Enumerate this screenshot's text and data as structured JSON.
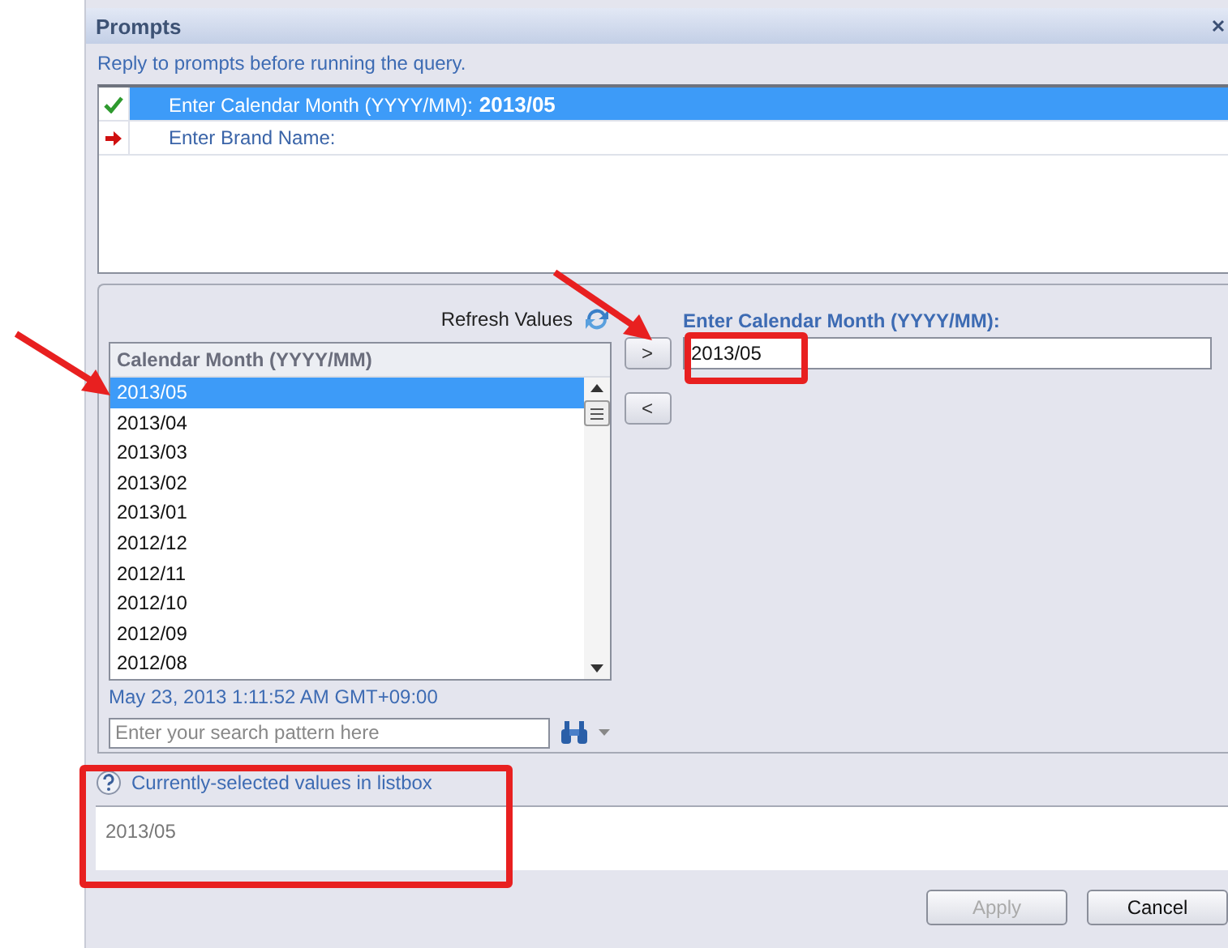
{
  "window": {
    "title": "Prompts"
  },
  "instruction": "Reply to prompts before running the query.",
  "prompts": [
    {
      "kind": "answered",
      "label": "Enter Calendar Month (YYYY/MM):",
      "value": "2013/05",
      "selected": true
    },
    {
      "kind": "pending",
      "label": "Enter Brand Name:",
      "selected": false
    }
  ],
  "refresh": {
    "label": "Refresh Values"
  },
  "listbox": {
    "header": "Calendar Month (YYYY/MM)",
    "rows": [
      {
        "label": "2013/05",
        "selected": true
      },
      {
        "label": "2013/04",
        "selected": false
      },
      {
        "label": "2013/03",
        "selected": false
      },
      {
        "label": "2013/02",
        "selected": false
      },
      {
        "label": "2013/01",
        "selected": false
      },
      {
        "label": "2012/12",
        "selected": false
      },
      {
        "label": "2012/11",
        "selected": false
      },
      {
        "label": "2012/10",
        "selected": false
      },
      {
        "label": "2012/09",
        "selected": false
      },
      {
        "label": "2012/08",
        "selected": false
      }
    ]
  },
  "move_buttons": [
    ">",
    "<"
  ],
  "answer": {
    "label": "Enter Calendar Month (YYYY/MM):",
    "value": "2013/05"
  },
  "timestamp": "May 23, 2013 1:11:52 AM GMT+09:00",
  "search": {
    "placeholder": "Enter your search pattern here"
  },
  "selected_values": {
    "title": "Currently-selected values in listbox",
    "values": "2013/05"
  },
  "buttons": [
    {
      "label": "Apply",
      "disabled": true
    },
    {
      "label": "Cancel",
      "disabled": false
    }
  ]
}
